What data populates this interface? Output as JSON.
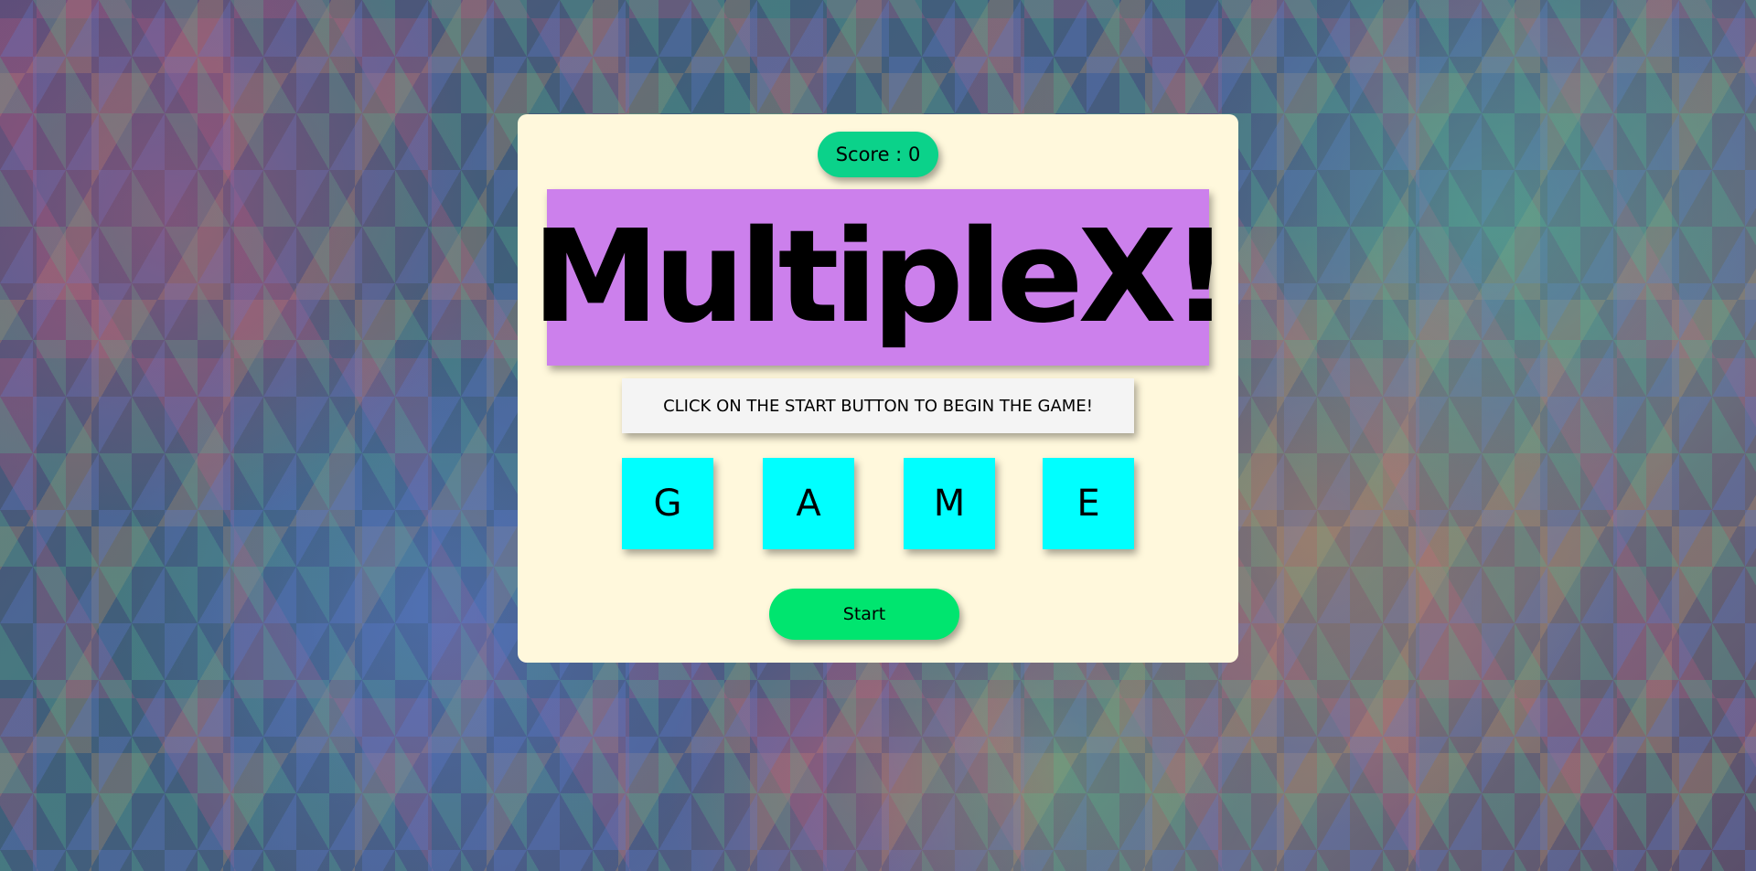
{
  "score": {
    "label": "Score : ",
    "value": "0"
  },
  "title": "MultipleX!",
  "message": "CLICK ON THE START BUTTON TO BEGIN THE GAME!",
  "tiles": [
    "G",
    "A",
    "M",
    "E"
  ],
  "start_label": "Start",
  "colors": {
    "card": "#fff8dc",
    "score_pill": "#0bd28a",
    "title_box": "#cc80ec",
    "message_box": "#f4f4f4",
    "tile": "#00ffff",
    "start_button": "#00e56f"
  }
}
